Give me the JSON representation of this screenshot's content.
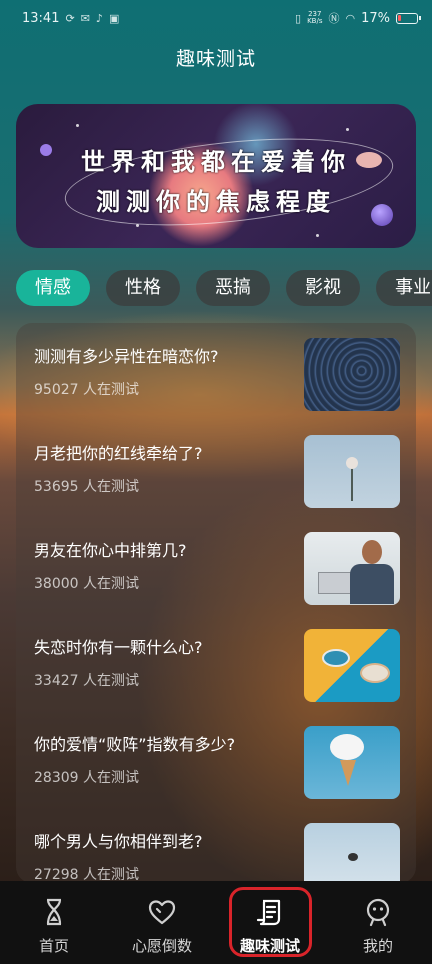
{
  "status_bar": {
    "time": "13:41",
    "left_icons": [
      "sync-icon",
      "wechat-icon",
      "tiktok-icon",
      "app-icon"
    ],
    "net_speed_value": "237",
    "net_speed_unit": "KB/s",
    "battery_percent": "17%"
  },
  "header": {
    "title": "趣味测试"
  },
  "banner": {
    "line1": "世界和我都在爱着你",
    "line2": "测测你的焦虑程度"
  },
  "tabs": [
    {
      "label": "情感",
      "active": true
    },
    {
      "label": "性格",
      "active": false
    },
    {
      "label": "恶搞",
      "active": false
    },
    {
      "label": "影视",
      "active": false
    },
    {
      "label": "事业",
      "active": false
    }
  ],
  "tests": [
    {
      "title": "测测有多少异性在暗恋你?",
      "count": "95027 人在测试",
      "thumb": "star-trails"
    },
    {
      "title": "月老把你的红线牵给了?",
      "count": "53695 人在测试",
      "thumb": "rose"
    },
    {
      "title": "男友在你心中排第几?",
      "count": "38000 人在测试",
      "thumb": "man-laptop"
    },
    {
      "title": "失恋时你有一颗什么心?",
      "count": "33427 人在测试",
      "thumb": "bowls"
    },
    {
      "title": "你的爱情“败阵”指数有多少?",
      "count": "28309 人在测试",
      "thumb": "cloud-cone"
    },
    {
      "title": "哪个男人与你相伴到老?",
      "count": "27298 人在测试",
      "thumb": "sky"
    }
  ],
  "bottom_nav": [
    {
      "label": "首页",
      "icon": "hourglass-icon",
      "active": false
    },
    {
      "label": "心愿倒数",
      "icon": "heart-icon",
      "active": false
    },
    {
      "label": "趣味测试",
      "icon": "scroll-icon",
      "active": true
    },
    {
      "label": "我的",
      "icon": "robot-face-icon",
      "active": false
    }
  ],
  "colors": {
    "accent": "#19b49a",
    "highlight": "#d9242a",
    "nav_bg": "#111111"
  }
}
